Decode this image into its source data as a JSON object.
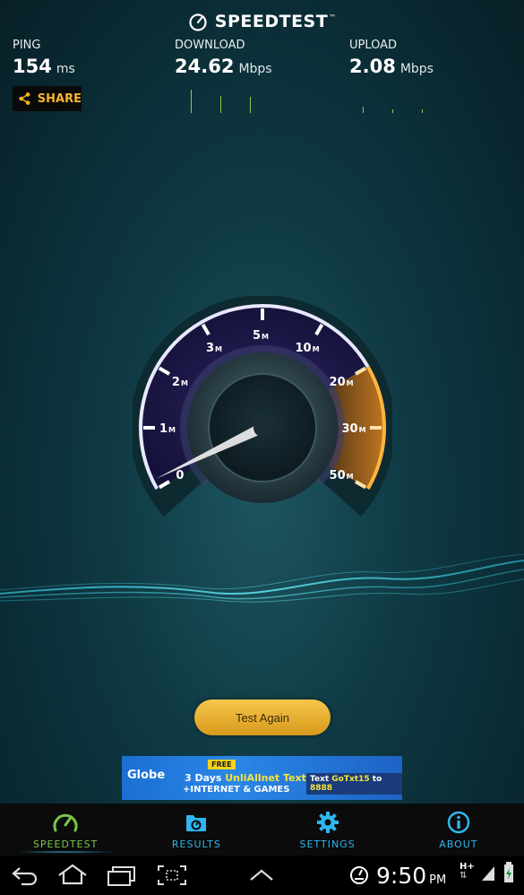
{
  "app": {
    "title": "SPEEDTEST",
    "trademark": "™"
  },
  "metrics": {
    "ping": {
      "label": "PING",
      "value": "154",
      "unit": "ms"
    },
    "download": {
      "label": "DOWNLOAD",
      "value": "24.62",
      "unit": "Mbps"
    },
    "upload": {
      "label": "UPLOAD",
      "value": "2.08",
      "unit": "Mbps"
    }
  },
  "share": {
    "label": "SHARE",
    "icon": "share-icon"
  },
  "gauge": {
    "tick_labels": [
      "0",
      "1",
      "2",
      "3",
      "5",
      "10",
      "20",
      "30",
      "50"
    ],
    "tick_unit": "M",
    "needle_value": 0.15
  },
  "actions": {
    "test_again": "Test Again"
  },
  "ad": {
    "brand": "Globe",
    "badge": "FREE",
    "line1_prefix": "3 Days ",
    "line1_highlight": "UnliAllnet Texts",
    "line2": "+INTERNET & GAMES",
    "sms_prefix": "Text ",
    "sms_code": "GoTxt15",
    "sms_mid": " to ",
    "sms_number": "8888"
  },
  "nav": [
    {
      "label": "SPEEDTEST",
      "icon": "gauge-icon",
      "active": true
    },
    {
      "label": "RESULTS",
      "icon": "results-icon",
      "active": false
    },
    {
      "label": "SETTINGS",
      "icon": "gear-icon",
      "active": false
    },
    {
      "label": "ABOUT",
      "icon": "info-icon",
      "active": false
    }
  ],
  "status_bar": {
    "time": "9:50",
    "ampm": "PM",
    "network": "H+"
  },
  "colors": {
    "accent_orange": "#f4a531",
    "accent_green": "#7bc64a",
    "accent_blue": "#2fb6ef",
    "gauge_purple": "#5b3fa8"
  }
}
